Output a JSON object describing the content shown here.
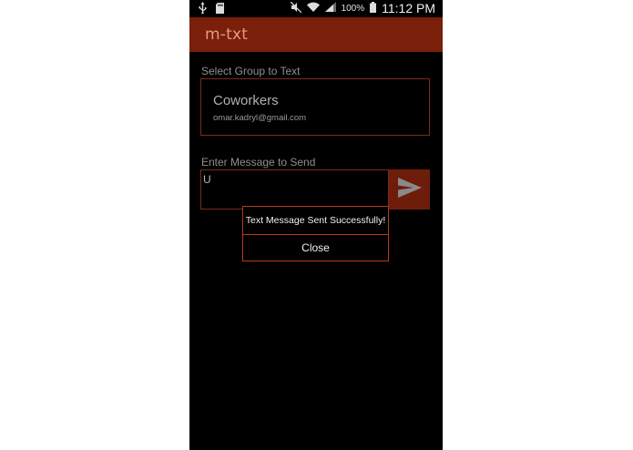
{
  "status_bar": {
    "battery_percent": "100%",
    "time": "11:12 PM",
    "icons": [
      "usb-icon",
      "sd-card-icon",
      "mute-icon",
      "wifi-icon",
      "signal-icon",
      "battery-icon"
    ]
  },
  "app_bar": {
    "title": "m-txt",
    "color": "#7a1f0a"
  },
  "group_section": {
    "label": "Select Group to Text",
    "group_name": "Coworkers",
    "group_email": "omar.kadryl@gmail.com"
  },
  "message_section": {
    "label": "Enter Message to Send",
    "value": "U"
  },
  "dialog": {
    "message": "Text Message Sent Successfully!",
    "close_label": "Close"
  },
  "colors": {
    "accent": "#b63a1e",
    "background": "#000000"
  }
}
